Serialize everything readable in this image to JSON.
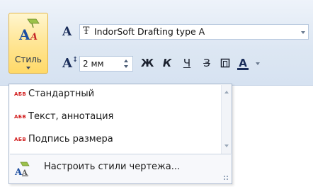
{
  "ribbon": {
    "style_button_label": "Стиль",
    "font_icon": "font-A-icon",
    "font_name": "IndorSoft Drafting type A",
    "size_icon": "font-size-icon",
    "font_size": "2 мм",
    "bold": "Ж",
    "italic": "К",
    "underline": "Ч",
    "strike": "З",
    "frame_icon": "frame-icon",
    "color": "A"
  },
  "menu": {
    "items": [
      {
        "badge": "АБВ",
        "label": "Стандартный"
      },
      {
        "badge": "АБВ",
        "label": "Текст, аннотация"
      },
      {
        "badge": "АБВ",
        "label": "Подпись размера"
      }
    ],
    "footer_label": "Настроить стили чертежа..."
  },
  "colors": {
    "accent_button": "#ffd968",
    "badge_red": "#d21f1f",
    "ribbon_bg": "#dde7f3"
  }
}
